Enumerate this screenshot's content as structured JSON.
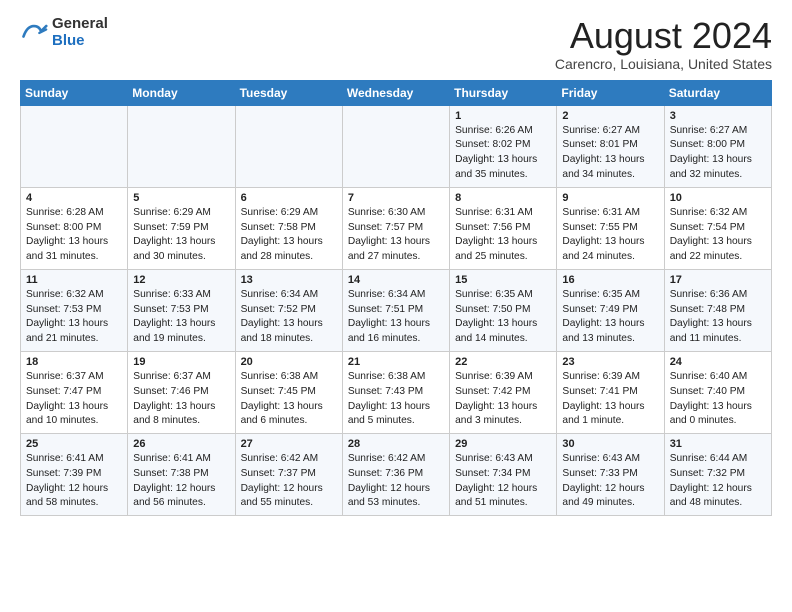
{
  "header": {
    "logo_general": "General",
    "logo_blue": "Blue",
    "month_title": "August 2024",
    "location": "Carencro, Louisiana, United States"
  },
  "days_of_week": [
    "Sunday",
    "Monday",
    "Tuesday",
    "Wednesday",
    "Thursday",
    "Friday",
    "Saturday"
  ],
  "weeks": [
    [
      {
        "day": "",
        "info": ""
      },
      {
        "day": "",
        "info": ""
      },
      {
        "day": "",
        "info": ""
      },
      {
        "day": "",
        "info": ""
      },
      {
        "day": "1",
        "info": "Sunrise: 6:26 AM\nSunset: 8:02 PM\nDaylight: 13 hours\nand 35 minutes."
      },
      {
        "day": "2",
        "info": "Sunrise: 6:27 AM\nSunset: 8:01 PM\nDaylight: 13 hours\nand 34 minutes."
      },
      {
        "day": "3",
        "info": "Sunrise: 6:27 AM\nSunset: 8:00 PM\nDaylight: 13 hours\nand 32 minutes."
      }
    ],
    [
      {
        "day": "4",
        "info": "Sunrise: 6:28 AM\nSunset: 8:00 PM\nDaylight: 13 hours\nand 31 minutes."
      },
      {
        "day": "5",
        "info": "Sunrise: 6:29 AM\nSunset: 7:59 PM\nDaylight: 13 hours\nand 30 minutes."
      },
      {
        "day": "6",
        "info": "Sunrise: 6:29 AM\nSunset: 7:58 PM\nDaylight: 13 hours\nand 28 minutes."
      },
      {
        "day": "7",
        "info": "Sunrise: 6:30 AM\nSunset: 7:57 PM\nDaylight: 13 hours\nand 27 minutes."
      },
      {
        "day": "8",
        "info": "Sunrise: 6:31 AM\nSunset: 7:56 PM\nDaylight: 13 hours\nand 25 minutes."
      },
      {
        "day": "9",
        "info": "Sunrise: 6:31 AM\nSunset: 7:55 PM\nDaylight: 13 hours\nand 24 minutes."
      },
      {
        "day": "10",
        "info": "Sunrise: 6:32 AM\nSunset: 7:54 PM\nDaylight: 13 hours\nand 22 minutes."
      }
    ],
    [
      {
        "day": "11",
        "info": "Sunrise: 6:32 AM\nSunset: 7:53 PM\nDaylight: 13 hours\nand 21 minutes."
      },
      {
        "day": "12",
        "info": "Sunrise: 6:33 AM\nSunset: 7:53 PM\nDaylight: 13 hours\nand 19 minutes."
      },
      {
        "day": "13",
        "info": "Sunrise: 6:34 AM\nSunset: 7:52 PM\nDaylight: 13 hours\nand 18 minutes."
      },
      {
        "day": "14",
        "info": "Sunrise: 6:34 AM\nSunset: 7:51 PM\nDaylight: 13 hours\nand 16 minutes."
      },
      {
        "day": "15",
        "info": "Sunrise: 6:35 AM\nSunset: 7:50 PM\nDaylight: 13 hours\nand 14 minutes."
      },
      {
        "day": "16",
        "info": "Sunrise: 6:35 AM\nSunset: 7:49 PM\nDaylight: 13 hours\nand 13 minutes."
      },
      {
        "day": "17",
        "info": "Sunrise: 6:36 AM\nSunset: 7:48 PM\nDaylight: 13 hours\nand 11 minutes."
      }
    ],
    [
      {
        "day": "18",
        "info": "Sunrise: 6:37 AM\nSunset: 7:47 PM\nDaylight: 13 hours\nand 10 minutes."
      },
      {
        "day": "19",
        "info": "Sunrise: 6:37 AM\nSunset: 7:46 PM\nDaylight: 13 hours\nand 8 minutes."
      },
      {
        "day": "20",
        "info": "Sunrise: 6:38 AM\nSunset: 7:45 PM\nDaylight: 13 hours\nand 6 minutes."
      },
      {
        "day": "21",
        "info": "Sunrise: 6:38 AM\nSunset: 7:43 PM\nDaylight: 13 hours\nand 5 minutes."
      },
      {
        "day": "22",
        "info": "Sunrise: 6:39 AM\nSunset: 7:42 PM\nDaylight: 13 hours\nand 3 minutes."
      },
      {
        "day": "23",
        "info": "Sunrise: 6:39 AM\nSunset: 7:41 PM\nDaylight: 13 hours\nand 1 minute."
      },
      {
        "day": "24",
        "info": "Sunrise: 6:40 AM\nSunset: 7:40 PM\nDaylight: 13 hours\nand 0 minutes."
      }
    ],
    [
      {
        "day": "25",
        "info": "Sunrise: 6:41 AM\nSunset: 7:39 PM\nDaylight: 12 hours\nand 58 minutes."
      },
      {
        "day": "26",
        "info": "Sunrise: 6:41 AM\nSunset: 7:38 PM\nDaylight: 12 hours\nand 56 minutes."
      },
      {
        "day": "27",
        "info": "Sunrise: 6:42 AM\nSunset: 7:37 PM\nDaylight: 12 hours\nand 55 minutes."
      },
      {
        "day": "28",
        "info": "Sunrise: 6:42 AM\nSunset: 7:36 PM\nDaylight: 12 hours\nand 53 minutes."
      },
      {
        "day": "29",
        "info": "Sunrise: 6:43 AM\nSunset: 7:34 PM\nDaylight: 12 hours\nand 51 minutes."
      },
      {
        "day": "30",
        "info": "Sunrise: 6:43 AM\nSunset: 7:33 PM\nDaylight: 12 hours\nand 49 minutes."
      },
      {
        "day": "31",
        "info": "Sunrise: 6:44 AM\nSunset: 7:32 PM\nDaylight: 12 hours\nand 48 minutes."
      }
    ]
  ]
}
